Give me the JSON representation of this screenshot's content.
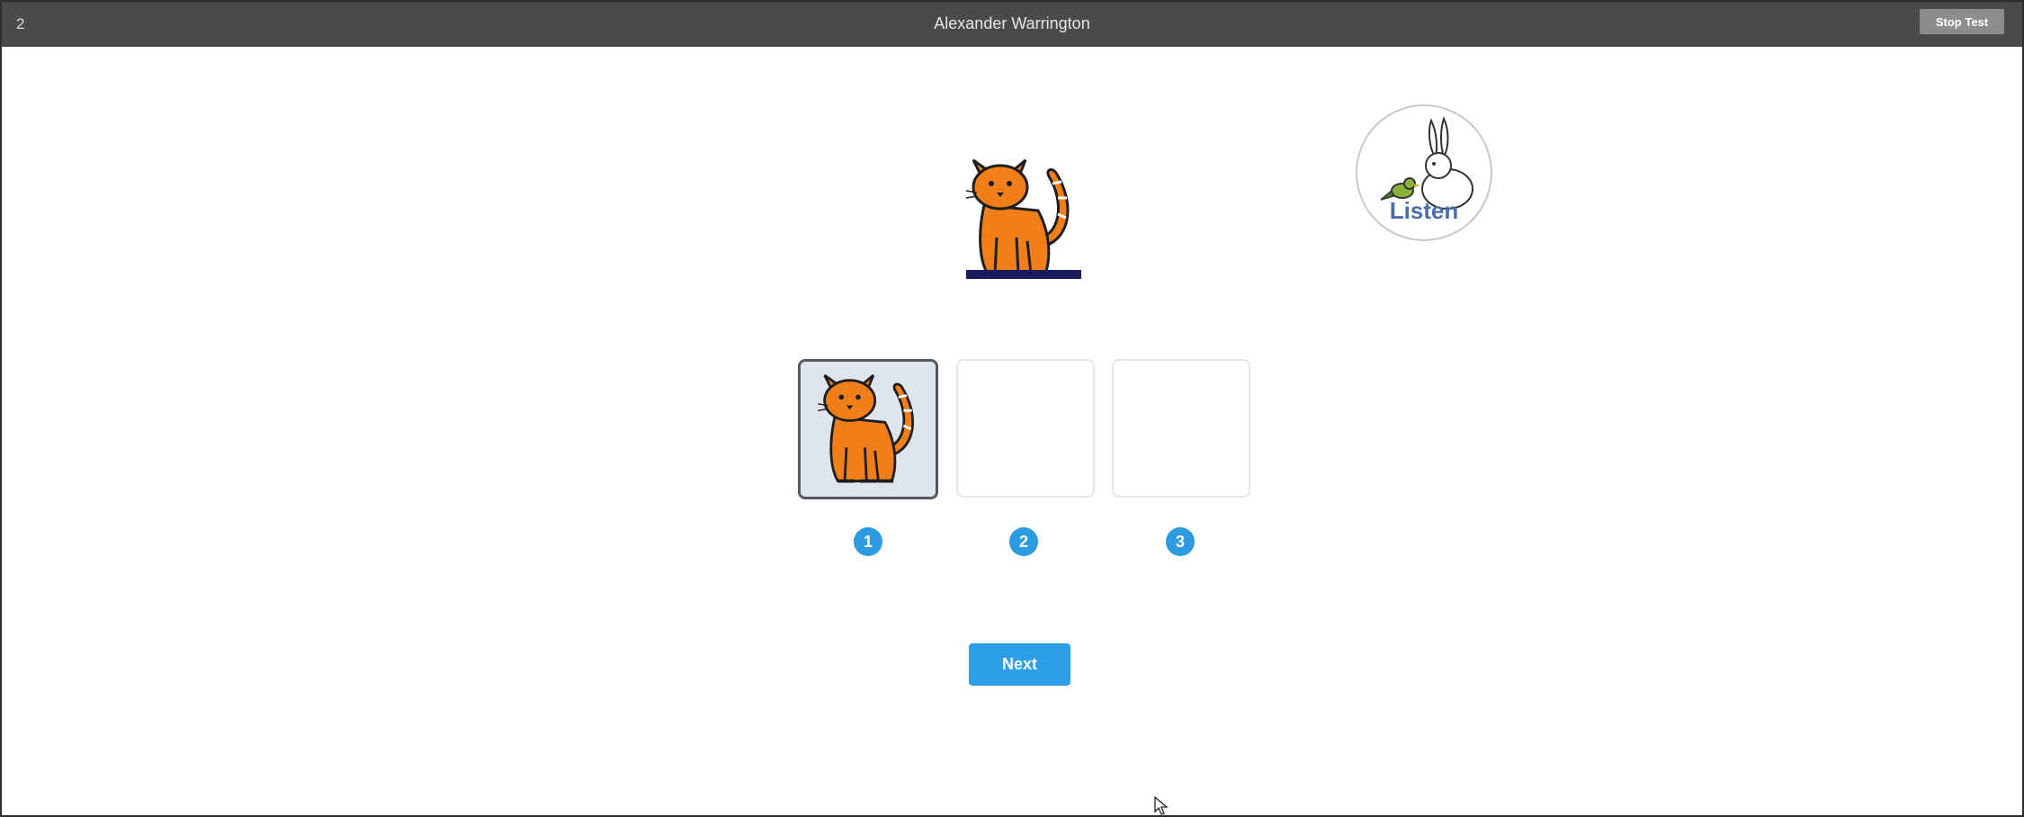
{
  "header": {
    "question_number": "2",
    "student_name": "Alexander Warrington",
    "stop_button_label": "Stop Test"
  },
  "prompt": {
    "image_icon": "cat-icon"
  },
  "listen_button": {
    "label": "Listen",
    "icon": "rabbit-and-bird-icon"
  },
  "answer_slots": [
    {
      "number": "1",
      "selected": true,
      "image_icon": "cat-icon"
    },
    {
      "number": "2",
      "selected": false,
      "image_icon": ""
    },
    {
      "number": "3",
      "selected": false,
      "image_icon": ""
    }
  ],
  "next_button": {
    "label": "Next"
  },
  "colors": {
    "topbar": "#4a4a4a",
    "accent_blue": "#2e9ee6",
    "cat_orange": "#f07f1a",
    "underline": "#1a1a5e"
  }
}
